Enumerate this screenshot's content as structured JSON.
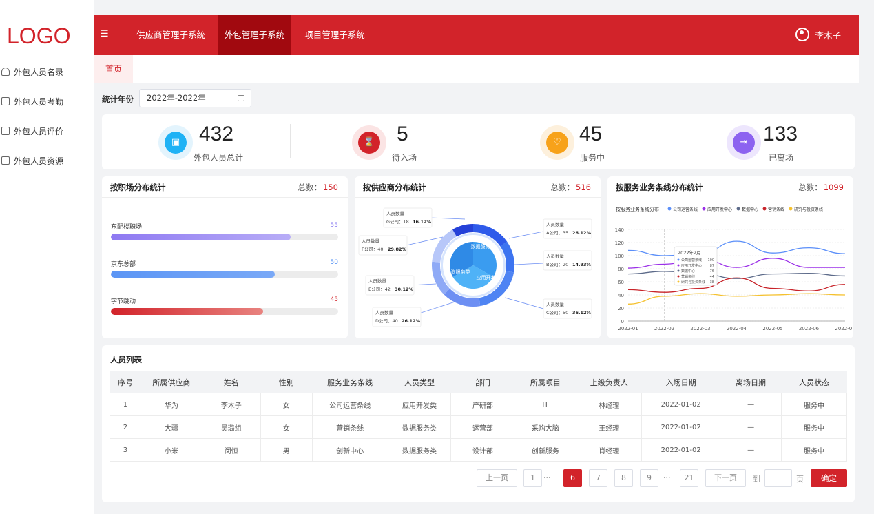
{
  "logo": "LOGO",
  "sidebar": {
    "items": [
      {
        "label": "外包人员名录"
      },
      {
        "label": "外包人员考勤"
      },
      {
        "label": "外包人员评价"
      },
      {
        "label": "外包人员资源"
      }
    ]
  },
  "topnav": {
    "tabs": [
      {
        "label": "供应商管理子系统"
      },
      {
        "label": "外包管理子系统"
      },
      {
        "label": "项目管理子系统"
      }
    ],
    "user": "李木子"
  },
  "tabbar": {
    "home": "首页"
  },
  "filter": {
    "label": "统计年份",
    "value": "2022年-2022年"
  },
  "stats": [
    {
      "value": "432",
      "label": "外包人员总计",
      "color": "#1fb2f5",
      "bg": "#e3f4fd"
    },
    {
      "value": "5",
      "label": "待入场",
      "color": "#d2232a",
      "bg": "#fbe4e4"
    },
    {
      "value": "45",
      "label": "服务中",
      "color": "#f7a21a",
      "bg": "#fdf0dc"
    },
    {
      "value": "133",
      "label": "已离场",
      "color": "#8c62f0",
      "bg": "#ede6fd"
    }
  ],
  "post_panel": {
    "title": "按职场分布统计",
    "total_label": "总数：",
    "total": "150",
    "rows": [
      {
        "name": "东配楼职场",
        "value": "55",
        "fraction": 0.79,
        "value_color": "#8a7cf0",
        "gradient": "linear-gradient(90deg,#8e79f2,#b8adf7)"
      },
      {
        "name": "京东总部",
        "value": "50",
        "fraction": 0.72,
        "value_color": "#4e8cf3",
        "gradient": "linear-gradient(90deg,#5b95f5,#7aa9f7)"
      },
      {
        "name": "字节跳动",
        "value": "45",
        "fraction": 0.67,
        "value_color": "#d2232a",
        "gradient": "linear-gradient(90deg,#d2232a,#e8837f)"
      }
    ]
  },
  "supplier_panel": {
    "title": "按供应商分布统计",
    "total_label": "总数：",
    "total": "516",
    "inner_labels": [
      "数据服务类",
      "咨询服务类",
      "应用开发类"
    ],
    "callouts": [
      {
        "title": "人员数量",
        "name": "G公司：18",
        "pct": "16.12%"
      },
      {
        "title": "人员数量",
        "name": "F公司：40",
        "pct": "29.82%"
      },
      {
        "title": "人员数量",
        "name": "E公司：42",
        "pct": "30.12%"
      },
      {
        "title": "人员数量",
        "name": "D公司：40",
        "pct": "26.12%"
      },
      {
        "title": "人员数量",
        "name": "A公司：35",
        "pct": "26.12%"
      },
      {
        "title": "人员数量",
        "name": "B公司：20",
        "pct": "14.93%"
      },
      {
        "title": "人员数量",
        "name": "C公司：50",
        "pct": "36.12%"
      }
    ]
  },
  "chart_data": {
    "type": "line",
    "title": "按服务业务条线分布统计",
    "legend_title": "按服务业务条线分布",
    "x": [
      "2022-01",
      "2022-02",
      "2022-03",
      "2022-04",
      "2022-05",
      "2022-06",
      "2022-07"
    ],
    "ylim": [
      0,
      140
    ],
    "yticks": [
      0,
      20,
      40,
      60,
      80,
      100,
      120,
      140
    ],
    "series": [
      {
        "name": "公司运营条线",
        "color": "#5b8ff9",
        "values": [
          108,
          100,
          103,
          122,
          104,
          112,
          103
        ]
      },
      {
        "name": "应用开发中心",
        "color": "#9b30e8",
        "values": [
          81,
          87,
          96,
          82,
          96,
          82,
          82
        ]
      },
      {
        "name": "数据中心",
        "color": "#5d6b8a",
        "values": [
          72,
          76,
          73,
          65,
          72,
          73,
          69
        ]
      },
      {
        "name": "营销条线",
        "color": "#c8242a",
        "values": [
          48,
          44,
          50,
          66,
          50,
          46,
          56
        ]
      },
      {
        "name": "研究与投资条线",
        "color": "#f5c12e",
        "values": [
          26,
          38,
          42,
          38,
          40,
          42,
          40
        ]
      }
    ],
    "tooltip": {
      "title": "2022年2月",
      "rows": [
        {
          "name": "公司运营条线",
          "value": "100"
        },
        {
          "name": "应用开发中心",
          "value": "87"
        },
        {
          "name": "数据中心",
          "value": "76"
        },
        {
          "name": "营销条线",
          "value": "44"
        },
        {
          "name": "研究与投资条线",
          "value": "38"
        }
      ]
    },
    "grid": true,
    "legend_position": "top"
  },
  "line_panel": {
    "title": "按服务业务条线分布统计",
    "total_label": "总数：",
    "total": "1099"
  },
  "table": {
    "title": "人员列表",
    "headers": [
      "序号",
      "所属供应商",
      "姓名",
      "性别",
      "服务业务条线",
      "人员类型",
      "部门",
      "所属项目",
      "上级负责人",
      "入场日期",
      "离场日期",
      "人员状态"
    ],
    "rows": [
      [
        "1",
        "华为",
        "李木子",
        "女",
        "公司运营条线",
        "应用开发类",
        "产研部",
        "IT",
        "林经理",
        "2022-01-02",
        "—",
        "服务中"
      ],
      [
        "2",
        "大疆",
        "吴璐组",
        "女",
        "营销条线",
        "数据服务类",
        "运营部",
        "采购大脑",
        "王经理",
        "2022-01-02",
        "—",
        "服务中"
      ],
      [
        "3",
        "小米",
        "闵恒",
        "男",
        "创新中心",
        "数据服务类",
        "设计部",
        "创新服务",
        "肖经理",
        "2022-01-02",
        "—",
        "服务中"
      ]
    ]
  },
  "pager": {
    "prev": "上一页",
    "pages": [
      "1",
      "···",
      "6",
      "7",
      "8",
      "9",
      "···",
      "21"
    ],
    "current": "6",
    "next": "下一页",
    "goto": "到",
    "page_unit": "页",
    "confirm": "确定"
  }
}
